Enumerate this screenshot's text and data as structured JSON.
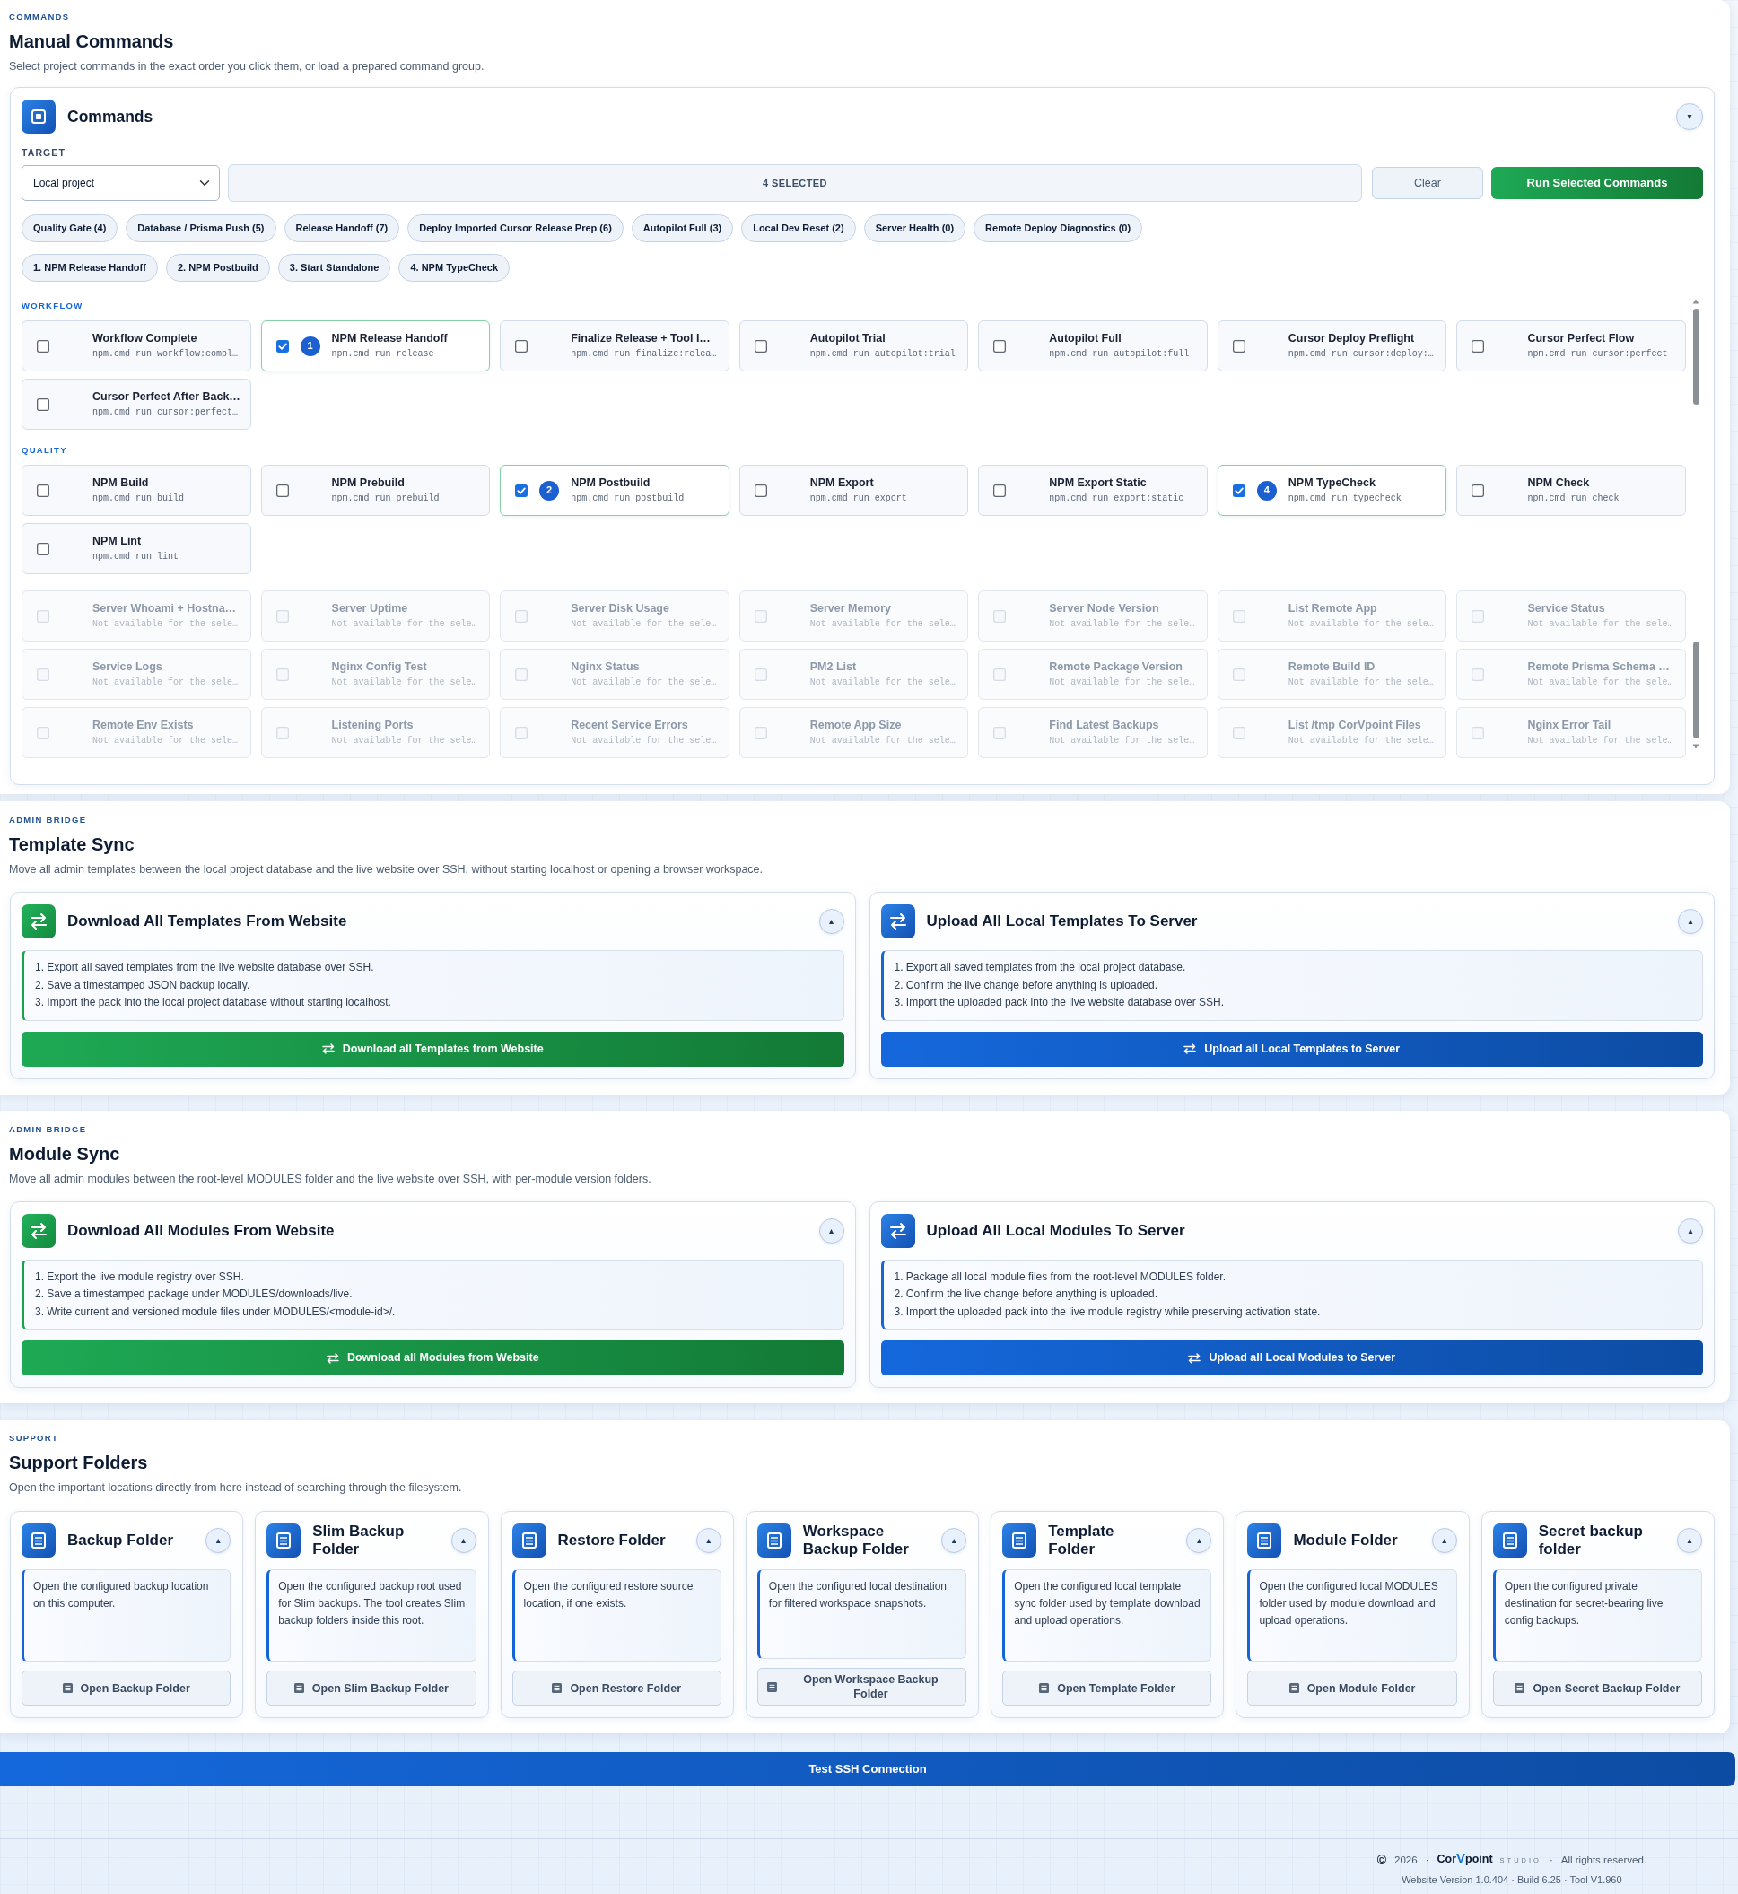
{
  "commands_section": {
    "eyebrow": "COMMANDS",
    "title": "Manual Commands",
    "description": "Select project commands in the exact order you click them, or load a prepared command group."
  },
  "commands_card": {
    "title": "Commands",
    "toggle": "▾",
    "target_label": "TARGET",
    "target_value": "Local project",
    "selection_count": "4 SELECTED",
    "clear_button": "Clear",
    "run_button": "Run Selected Commands",
    "presets": [
      "Quality Gate (4)",
      "Database / Prisma Push (5)",
      "Release Handoff (7)",
      "Deploy Imported Cursor Release Prep (6)",
      "Autopilot Full (3)",
      "Local Dev Reset (2)",
      "Server Health (0)",
      "Remote Deploy Diagnostics (0)"
    ],
    "selected_order": [
      "1. NPM Release Handoff",
      "2. NPM Postbuild",
      "3. Start Standalone",
      "4. NPM TypeCheck"
    ],
    "groups": [
      {
        "label": "WORKFLOW",
        "items": [
          {
            "title": "Workflow Complete",
            "command": "npm.cmd run workflow:compl…",
            "checked": false,
            "disabled": false
          },
          {
            "title": "NPM Release Handoff",
            "command": "npm.cmd run release",
            "checked": true,
            "disabled": false,
            "order": "1"
          },
          {
            "title": "Finalize Release + Tool I…",
            "command": "npm.cmd run finalize:relea…",
            "checked": false,
            "disabled": false
          },
          {
            "title": "Autopilot Trial",
            "command": "npm.cmd run autopilot:trial",
            "checked": false,
            "disabled": false
          },
          {
            "title": "Autopilot Full",
            "command": "npm.cmd run autopilot:full",
            "checked": false,
            "disabled": false
          },
          {
            "title": "Cursor Deploy Preflight",
            "command": "npm.cmd run cursor:deploy:…",
            "checked": false,
            "disabled": false
          },
          {
            "title": "Cursor Perfect Flow",
            "command": "npm.cmd run cursor:perfect",
            "checked": false,
            "disabled": false
          },
          {
            "title": "Cursor Perfect After Back…",
            "command": "npm.cmd run cursor:perfect…",
            "checked": false,
            "disabled": false
          }
        ]
      },
      {
        "label": "QUALITY",
        "items": [
          {
            "title": "NPM Build",
            "command": "npm.cmd run build",
            "checked": false,
            "disabled": false
          },
          {
            "title": "NPM Prebuild",
            "command": "npm.cmd run prebuild",
            "checked": false,
            "disabled": false
          },
          {
            "title": "NPM Postbuild",
            "command": "npm.cmd run postbuild",
            "checked": true,
            "disabled": false,
            "order": "2"
          },
          {
            "title": "NPM Export",
            "command": "npm.cmd run export",
            "checked": false,
            "disabled": false
          },
          {
            "title": "NPM Export Static",
            "command": "npm.cmd run export:static",
            "checked": false,
            "disabled": false
          },
          {
            "title": "NPM TypeCheck",
            "command": "npm.cmd run typecheck",
            "checked": true,
            "disabled": false,
            "order": "4"
          },
          {
            "title": "NPM Check",
            "command": "npm.cmd run check",
            "checked": false,
            "disabled": false
          },
          {
            "title": "NPM Lint",
            "command": "npm.cmd run lint",
            "checked": false,
            "disabled": false
          }
        ]
      },
      {
        "items": [
          {
            "title": "Server Whoami + Hostna…",
            "command": "Not available for the sele…",
            "checked": false,
            "disabled": true
          },
          {
            "title": "Server Uptime",
            "command": "Not available for the sele…",
            "checked": false,
            "disabled": true
          },
          {
            "title": "Server Disk Usage",
            "command": "Not available for the sele…",
            "checked": false,
            "disabled": true
          },
          {
            "title": "Server Memory",
            "command": "Not available for the sele…",
            "checked": false,
            "disabled": true
          },
          {
            "title": "Server Node Version",
            "command": "Not available for the sele…",
            "checked": false,
            "disabled": true
          },
          {
            "title": "List Remote App",
            "command": "Not available for the sele…",
            "checked": false,
            "disabled": true
          },
          {
            "title": "Service Status",
            "command": "Not available for the sele…",
            "checked": false,
            "disabled": true
          },
          {
            "title": "Service Logs",
            "command": "Not available for the sele…",
            "checked": false,
            "disabled": true
          },
          {
            "title": "Nginx Config Test",
            "command": "Not available for the sele…",
            "checked": false,
            "disabled": true
          },
          {
            "title": "Nginx Status",
            "command": "Not available for the sele…",
            "checked": false,
            "disabled": true
          },
          {
            "title": "PM2 List",
            "command": "Not available for the sele…",
            "checked": false,
            "disabled": true
          },
          {
            "title": "Remote Package Version",
            "command": "Not available for the sele…",
            "checked": false,
            "disabled": true
          },
          {
            "title": "Remote Build ID",
            "command": "Not available for the sele…",
            "checked": false,
            "disabled": true
          },
          {
            "title": "Remote Prisma Schema …",
            "command": "Not available for the sele…",
            "checked": false,
            "disabled": true
          },
          {
            "title": "Remote Env Exists",
            "command": "Not available for the sele…",
            "checked": false,
            "disabled": true
          },
          {
            "title": "Listening Ports",
            "command": "Not available for the sele…",
            "checked": false,
            "disabled": true
          },
          {
            "title": "Recent Service Errors",
            "command": "Not available for the sele…",
            "checked": false,
            "disabled": true
          },
          {
            "title": "Remote App Size",
            "command": "Not available for the sele…",
            "checked": false,
            "disabled": true
          },
          {
            "title": "Find Latest Backups",
            "command": "Not available for the sele…",
            "checked": false,
            "disabled": true
          },
          {
            "title": "List /tmp CorVpoint Files",
            "command": "Not available for the sele…",
            "checked": false,
            "disabled": true
          },
          {
            "title": "Nginx Error Tail",
            "command": "Not available for the sele…",
            "checked": false,
            "disabled": true
          }
        ]
      }
    ]
  },
  "template_sync": {
    "eyebrow": "ADMIN BRIDGE",
    "title": "Template Sync",
    "description": "Move all admin templates between the local project database and the live website over SSH, without starting localhost or opening a browser workspace.",
    "cards": [
      {
        "kind": "download",
        "title": "Download All Templates From Website",
        "toggle": "▴",
        "steps": [
          "1. Export all saved templates from the live website database over SSH.",
          "2. Save a timestamped JSON backup locally.",
          "3. Import the pack into the local project database without starting localhost."
        ],
        "button": "Download all Templates from Website"
      },
      {
        "kind": "upload",
        "title": "Upload All Local Templates To Server",
        "toggle": "▴",
        "steps": [
          "1. Export all saved templates from the local project database.",
          "2. Confirm the live change before anything is uploaded.",
          "3. Import the uploaded pack into the live website database over SSH."
        ],
        "button": "Upload all Local Templates to Server"
      }
    ]
  },
  "module_sync": {
    "eyebrow": "ADMIN BRIDGE",
    "title": "Module Sync",
    "description": "Move all admin modules between the root-level MODULES folder and the live website over SSH, with per-module version folders.",
    "cards": [
      {
        "kind": "download",
        "title": "Download All Modules From Website",
        "toggle": "▴",
        "steps": [
          "1. Export the live module registry over SSH.",
          "2. Save a timestamped package under MODULES/downloads/live.",
          "3. Write current and versioned module files under MODULES/<module-id>/."
        ],
        "button": "Download all Modules from Website"
      },
      {
        "kind": "upload",
        "title": "Upload All Local Modules To Server",
        "toggle": "▴",
        "steps": [
          "1. Package all local module files from the root-level MODULES folder.",
          "2. Confirm the live change before anything is uploaded.",
          "3. Import the uploaded pack into the live module registry while preserving activation state."
        ],
        "button": "Upload all Local Modules to Server"
      }
    ]
  },
  "support": {
    "eyebrow": "SUPPORT",
    "title": "Support Folders",
    "description": "Open the important locations directly from here instead of searching through the filesystem.",
    "cards": [
      {
        "title": "Backup Folder",
        "toggle": "▴",
        "description": "Open the configured backup location on this computer.",
        "button": "Open Backup Folder"
      },
      {
        "title": "Slim Backup Folder",
        "toggle": "▴",
        "description": "Open the configured backup root used for Slim backups. The tool creates Slim backup folders inside this root.",
        "button": "Open Slim Backup Folder"
      },
      {
        "title": "Restore Folder",
        "toggle": "▴",
        "description": "Open the configured restore source location, if one exists.",
        "button": "Open Restore Folder"
      },
      {
        "title": "Workspace Backup Folder",
        "toggle": "▴",
        "description": "Open the configured local destination for filtered workspace snapshots.",
        "button": "Open Workspace Backup Folder"
      },
      {
        "title": "Template Folder",
        "toggle": "▴",
        "description": "Open the configured local template sync folder used by template download and upload operations.",
        "button": "Open Template Folder"
      },
      {
        "title": "Module Folder",
        "toggle": "▴",
        "description": "Open the configured local MODULES folder used by module download and upload operations.",
        "button": "Open Module Folder"
      },
      {
        "title": "Secret backup folder",
        "toggle": "▴",
        "description": "Open the configured private destination for secret-bearing live config backups.",
        "button": "Open Secret Backup Folder"
      }
    ]
  },
  "test_ssh_button": "Test SSH Connection",
  "footer": {
    "line": [
      {
        "kind": "symbol",
        "text": "©"
      },
      {
        "kind": "text",
        "text": "2026"
      },
      {
        "kind": "separator",
        "text": "·"
      },
      {
        "kind": "logo",
        "lead": "Cor",
        "mark": "V",
        "tail": "point",
        "tagline": "STUDIO"
      },
      {
        "kind": "separator",
        "text": "·"
      },
      {
        "kind": "text",
        "text": "All rights reserved."
      }
    ],
    "version": "Website Version 1.0.404 · Build 6.25 · Tool V1.960"
  }
}
